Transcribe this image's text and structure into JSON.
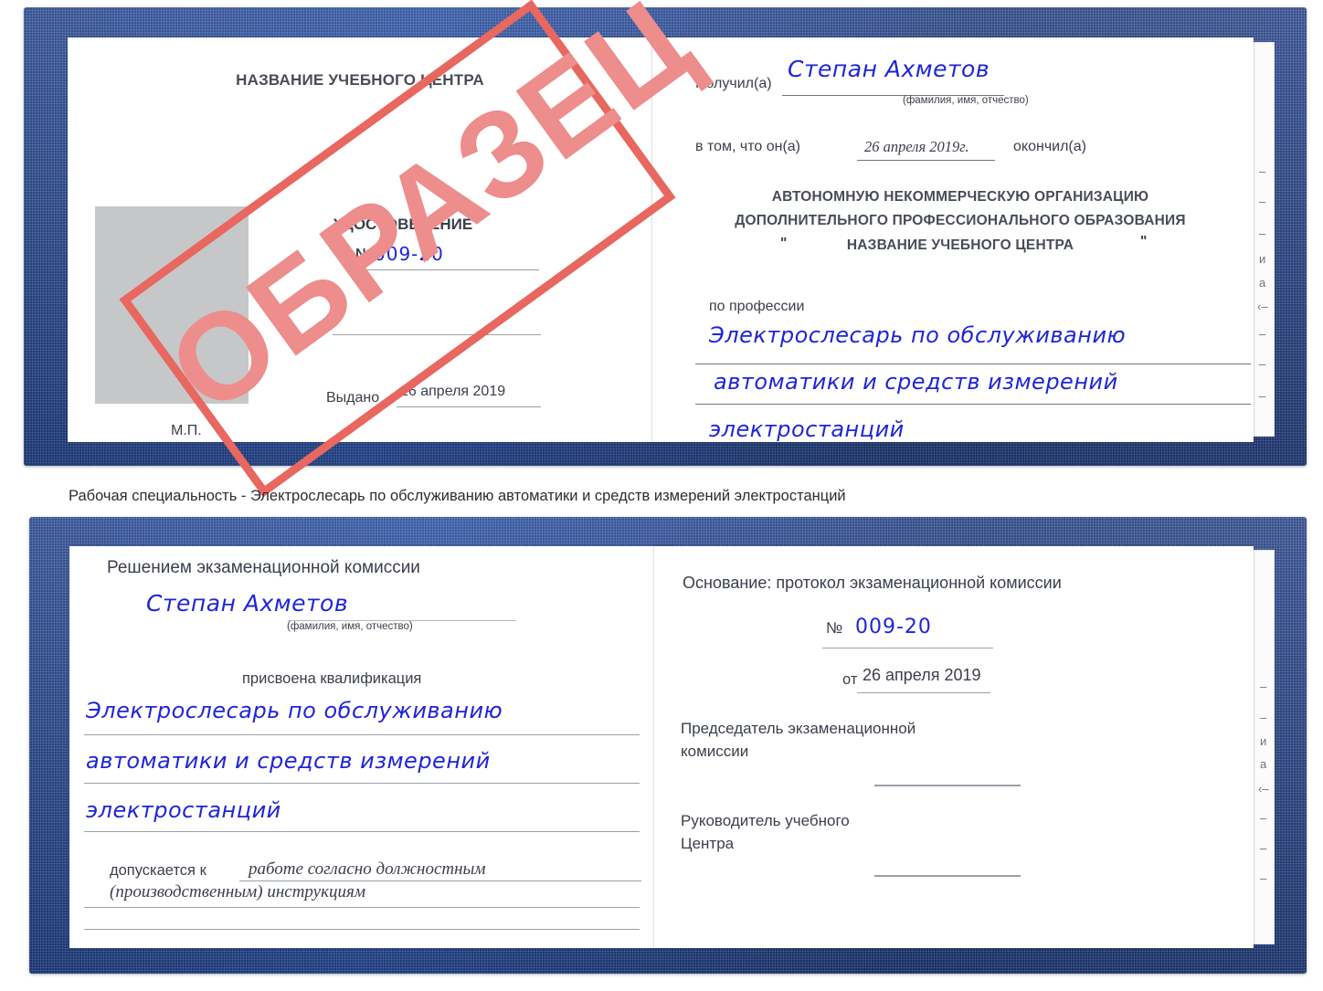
{
  "watermark": {
    "text": "ОБРАЗЕЦ",
    "border_color": "#e8675f",
    "text_color": "#ed8d8c"
  },
  "colors": {
    "cover_blue": "#1e3f86",
    "handwriting_blue": "#1f25d8",
    "paper": "#ffffff",
    "photo_placeholder": "#c6c7c9"
  },
  "certificate_top": {
    "left_page": {
      "org_title": "НАЗВАНИЕ УЧЕБНОГО ЦЕНТРА",
      "doc_type": "УДОСТОВЕРЕНИЕ",
      "number_label": "№",
      "number_value": "009-20",
      "issued_label": "Выдано",
      "issued_value": "26 апреля 2019",
      "stamp_label": "М.П."
    },
    "right_page": {
      "received_label": "Получил(а)",
      "received_value": "Степан Ахметов",
      "fio_hint": "(фамилия, имя, отчество)",
      "in_that_label": "в том, что он(а)",
      "finish_date": "26 апреля 2019г.",
      "finished_label": "окончил(а)",
      "org_line1": "АВТОНОМНУЮ НЕКОММЕРЧЕСКУЮ ОРГАНИЗАЦИЮ",
      "org_line2": "ДОПОЛНИТЕЛЬНОГО ПРОФЕССИОНАЛЬНОГО ОБРАЗОВАНИЯ",
      "org_quote_open": "\"",
      "org_line3": "НАЗВАНИЕ УЧЕБНОГО ЦЕНТРА",
      "org_quote_close": "\"",
      "profession_label": "по профессии",
      "profession_line1": "Электрослесарь по обслуживанию",
      "profession_line2": "автоматики и средств измерений",
      "profession_line3": "электростанций",
      "edge_fragments": [
        "–",
        "–",
        "–",
        "и",
        "а",
        "‹–",
        "–",
        "–",
        "–"
      ]
    }
  },
  "caption": "Рабочая специальность - Электрослесарь по обслуживанию автоматики и средств измерений электростанций",
  "certificate_bottom": {
    "left_page": {
      "decision_title": "Решением экзаменационной комиссии",
      "name_value": "Степан Ахметов",
      "fio_hint": "(фамилия, имя, отчество)",
      "qualification_label": "присвоена квалификация",
      "qualification_line1": "Электрослесарь по обслуживанию",
      "qualification_line2": "автоматики и средств измерений",
      "qualification_line3": "электростанций",
      "admitted_label": "допускается к",
      "admitted_value_line1": "работе согласно должностным",
      "admitted_value_line2": "(производственным) инструкциям"
    },
    "right_page": {
      "basis_label": "Основание: протокол экзаменационной комиссии",
      "number_label": "№",
      "number_value": "009-20",
      "date_label": "от",
      "date_value": "26 апреля 2019",
      "chairman_line1": "Председатель экзаменационной",
      "chairman_line2": "комиссии",
      "head_line1": "Руководитель учебного",
      "head_line2": "Центра",
      "edge_fragments": [
        "–",
        "–",
        "и",
        "а",
        "‹–",
        "–",
        "–",
        "–"
      ]
    }
  }
}
